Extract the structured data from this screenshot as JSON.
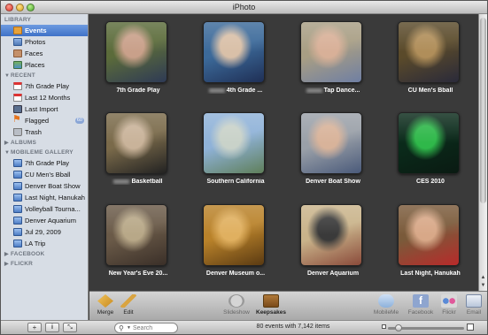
{
  "window": {
    "title": "iPhoto"
  },
  "sidebar": {
    "library": {
      "header": "LIBRARY",
      "items": [
        {
          "label": "Events",
          "icon": "events-icon",
          "selected": true
        },
        {
          "label": "Photos",
          "icon": "photos-icon"
        },
        {
          "label": "Faces",
          "icon": "faces-icon"
        },
        {
          "label": "Places",
          "icon": "places-icon"
        }
      ]
    },
    "recent": {
      "header": "RECENT",
      "items": [
        {
          "label": "7th Grade Play",
          "icon": "event-calendar-icon"
        },
        {
          "label": "Last 12 Months",
          "icon": "calendar-icon"
        },
        {
          "label": "Last Import",
          "icon": "import-icon"
        },
        {
          "label": "Flagged",
          "icon": "flag-icon",
          "badge": "60"
        },
        {
          "label": "Trash",
          "icon": "trash-icon"
        }
      ]
    },
    "albums": {
      "header": "ALBUMS"
    },
    "mobileme": {
      "header": "MOBILEME GALLERY",
      "items": [
        {
          "label": "7th Grade Play"
        },
        {
          "label": "CU Men's Bball"
        },
        {
          "label": "Denver Boat Show"
        },
        {
          "label": "Last Night, Hanukah"
        },
        {
          "label": "Volleyball Tourna..."
        },
        {
          "label": "Denver Aquarium"
        },
        {
          "label": "Jul 29, 2009"
        },
        {
          "label": "LA Trip"
        }
      ]
    },
    "facebook": {
      "header": "FACEBOOK"
    },
    "flickr": {
      "header": "FLICKR"
    }
  },
  "events": [
    {
      "title": "7th Grade Play",
      "prefix_blur": false,
      "colors": [
        "#5b6b3a",
        "#c9a08a",
        "#2e3a55"
      ]
    },
    {
      "title": "4th Grade ...",
      "prefix_blur": true,
      "colors": [
        "#3c6a9a",
        "#d9c0a8",
        "#1f2f55"
      ]
    },
    {
      "title": "Tap Dance...",
      "prefix_blur": true,
      "colors": [
        "#a89e84",
        "#d8b098",
        "#6f7fa3"
      ]
    },
    {
      "title": "CU Men's Bball",
      "prefix_blur": false,
      "colors": [
        "#5a4a2a",
        "#b08e5a",
        "#2a2a3a"
      ]
    },
    {
      "title": "Basketball",
      "prefix_blur": true,
      "colors": [
        "#7a6a4a",
        "#c9b39a",
        "#222"
      ]
    },
    {
      "title": "Southern California",
      "prefix_blur": false,
      "colors": [
        "#8fb2d8",
        "#c9d2c9",
        "#5f7f5a"
      ]
    },
    {
      "title": "Denver Boat Show",
      "prefix_blur": false,
      "colors": [
        "#9aa0a8",
        "#d8b39a",
        "#4a5a7a"
      ]
    },
    {
      "title": "CES 2010",
      "prefix_blur": false,
      "colors": [
        "#0a2a1a",
        "#2fb84a",
        "#0a1a12"
      ]
    },
    {
      "title": "New Year's Eve 20...",
      "prefix_blur": false,
      "colors": [
        "#6a5a48",
        "#b8a888",
        "#3a2f28"
      ]
    },
    {
      "title": "Denver Museum o...",
      "prefix_blur": false,
      "colors": [
        "#b9822a",
        "#e0b060",
        "#5a3a12"
      ]
    },
    {
      "title": "Denver Aquarium",
      "prefix_blur": false,
      "colors": [
        "#c9b38a",
        "#3a3a3a",
        "#8a4a3a"
      ]
    },
    {
      "title": "Last Night, Hanukah",
      "prefix_blur": false,
      "colors": [
        "#7a5a3a",
        "#d8a888",
        "#b82a2a"
      ]
    }
  ],
  "toolbar": {
    "merge": "Merge",
    "edit": "Edit",
    "slideshow": "Slideshow",
    "keepsakes": "Keepsakes",
    "mobileme": "MobileMe",
    "facebook": "Facebook",
    "flickr": "Flickr",
    "email": "Email"
  },
  "statusbar": {
    "add": "+",
    "info": "i",
    "fullscreen": "⤡",
    "search_placeholder": "Search",
    "summary": "80 events with 7,142 items",
    "zoom_level": 0.1
  }
}
